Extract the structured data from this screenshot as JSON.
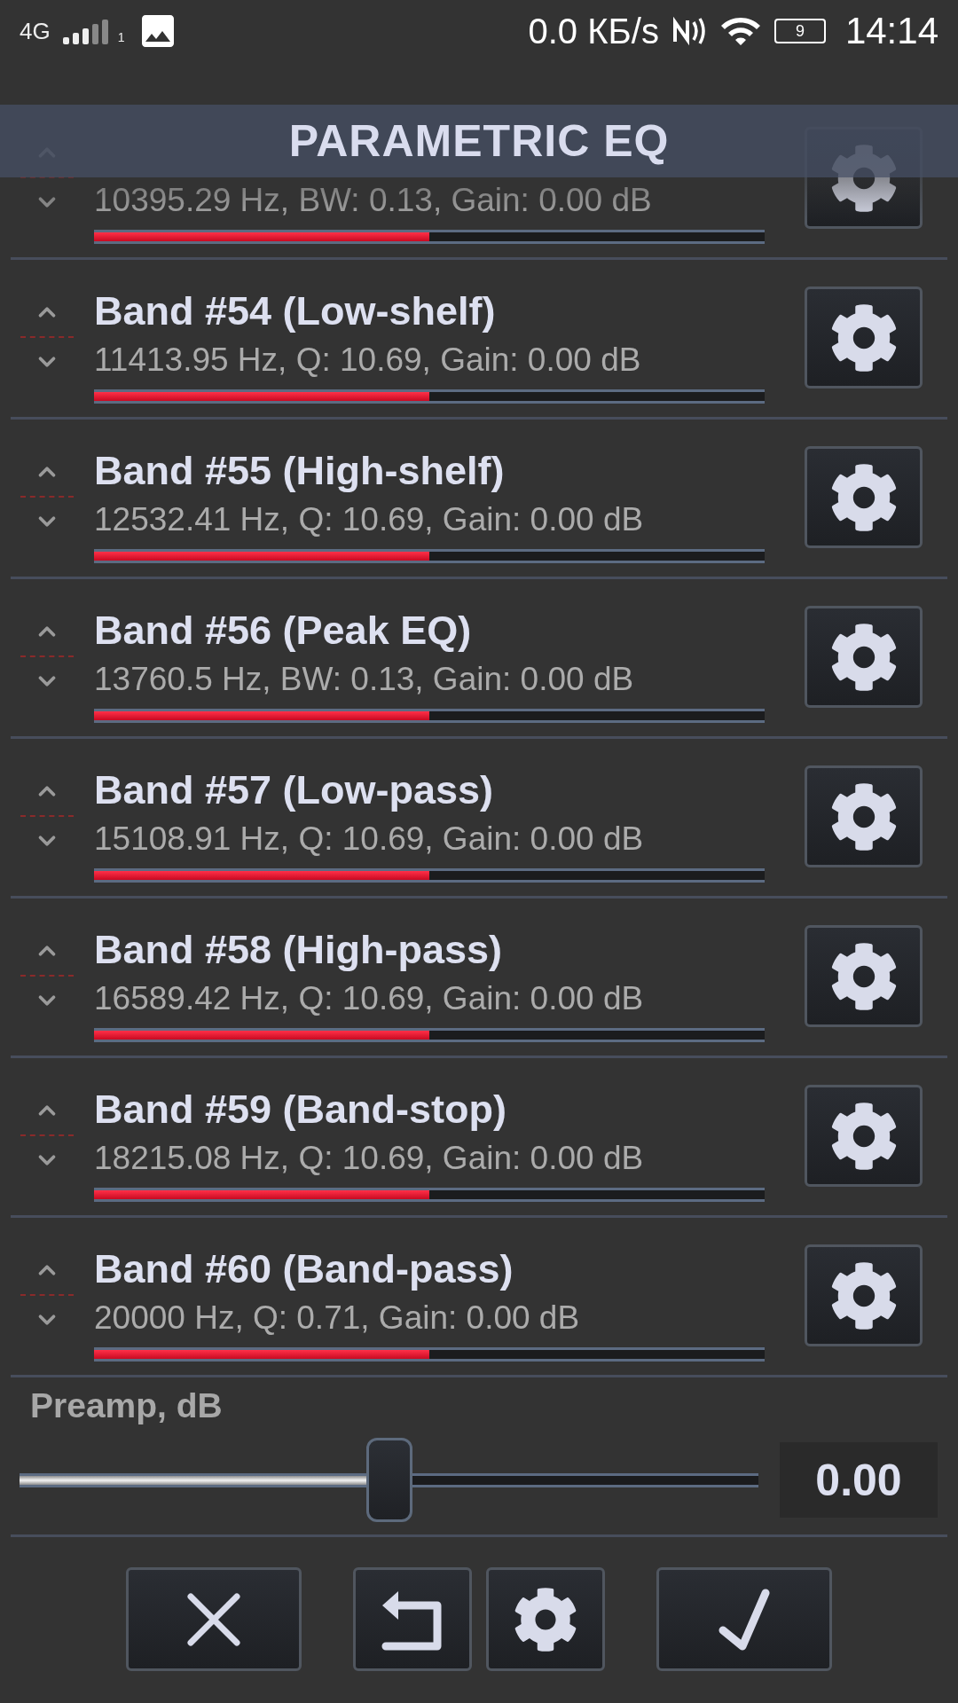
{
  "status_bar": {
    "network": "4G",
    "sim": "1",
    "speed": "0.0 КБ/s",
    "battery": "9",
    "time": "14:14"
  },
  "title": "PARAMETRIC EQ",
  "bands": [
    {
      "params": "10395.29 Hz, BW: 0.13, Gain: 0.00 dB",
      "level": 0.5
    },
    {
      "title": "Band #54 (Low-shelf)",
      "params": "11413.95 Hz, Q: 10.69, Gain: 0.00 dB",
      "level": 0.5
    },
    {
      "title": "Band #55 (High-shelf)",
      "params": "12532.41 Hz, Q: 10.69, Gain: 0.00 dB",
      "level": 0.5
    },
    {
      "title": "Band #56 (Peak EQ)",
      "params": "13760.5 Hz, BW: 0.13, Gain: 0.00 dB",
      "level": 0.5
    },
    {
      "title": "Band #57 (Low-pass)",
      "params": "15108.91 Hz, Q: 10.69, Gain: 0.00 dB",
      "level": 0.5
    },
    {
      "title": "Band #58 (High-pass)",
      "params": "16589.42 Hz, Q: 10.69, Gain: 0.00 dB",
      "level": 0.5
    },
    {
      "title": "Band #59 (Band-stop)",
      "params": "18215.08 Hz, Q: 10.69, Gain: 0.00 dB",
      "level": 0.5
    },
    {
      "title": "Band #60 (Band-pass)",
      "params": "20000 Hz, Q: 0.71, Gain: 0.00 dB",
      "level": 0.5
    }
  ],
  "preamp": {
    "label": "Preamp, dB",
    "level": 0.5,
    "value": "0.00"
  },
  "actions": [
    {
      "kind": "cancel"
    },
    {
      "kind": "reset"
    },
    {
      "kind": "settings"
    },
    {
      "kind": "apply"
    }
  ]
}
